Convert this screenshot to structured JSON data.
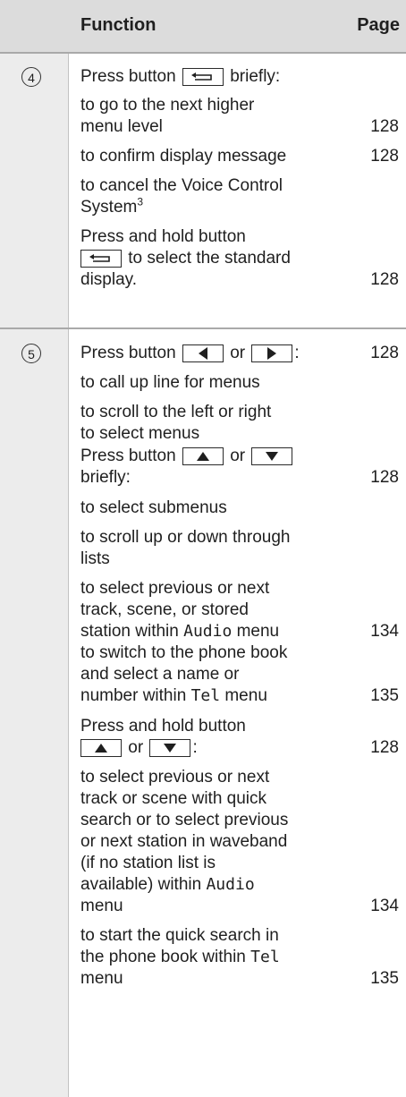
{
  "header": {
    "function": "Function",
    "page": "Page"
  },
  "row1": {
    "number": "4",
    "press_prefix": "Press button",
    "press_suffix": "briefly:",
    "item_next_level_1": "to go to the next higher",
    "item_next_level_2": "menu level",
    "item_confirm": "to confirm display message",
    "item_cancel_1": "to cancel the Voice Control",
    "item_cancel_2": "System",
    "item_cancel_sup": "3",
    "hold_prefix": "Press and hold button",
    "hold_suffix": "to select the standard",
    "hold_suffix_2": "display.",
    "pages": [
      "128",
      "128",
      "128"
    ]
  },
  "row2": {
    "number": "5",
    "press_lr_prefix": "Press button",
    "press_lr_or": "or",
    "press_lr_suffix": ":",
    "call_up": "to call up line for menus",
    "scroll_lr_1": "to scroll to the left or right",
    "scroll_lr_2": "to select menus",
    "press_ud_prefix": "Press button",
    "press_ud_or": "or",
    "press_ud_suffix": "briefly:",
    "submenus": "to select submenus",
    "scroll_ud_1": "to scroll up or down through",
    "scroll_ud_2": "lists",
    "track_1": "to select previous or next",
    "track_2": "track, scene, or stored",
    "track_3_prefix": "station within",
    "track_3_mono": "Audio",
    "track_3_suffix": "menu",
    "phone_1": "to switch to the phone book",
    "phone_2": "and select a name or",
    "phone_3_prefix": "number within",
    "phone_3_mono": "Tel",
    "phone_3_suffix": "menu",
    "hold_prefix": "Press and hold button",
    "hold_or": "or",
    "hold_suffix": ":",
    "quick_1": "to select previous or next",
    "quick_2": "track or scene with quick",
    "quick_3": "search or to select previous",
    "quick_4": "or next station in waveband",
    "quick_5": "(if no station list is",
    "quick_6_prefix": "available) within",
    "quick_6_mono": "Audio",
    "quick_7": "menu",
    "start_1": "to start the quick search in",
    "start_2_prefix": "the phone book within",
    "start_2_mono": "Tel",
    "start_3": "menu",
    "pages": [
      "128",
      "128",
      "134",
      "135",
      "128",
      "134",
      "135"
    ]
  }
}
